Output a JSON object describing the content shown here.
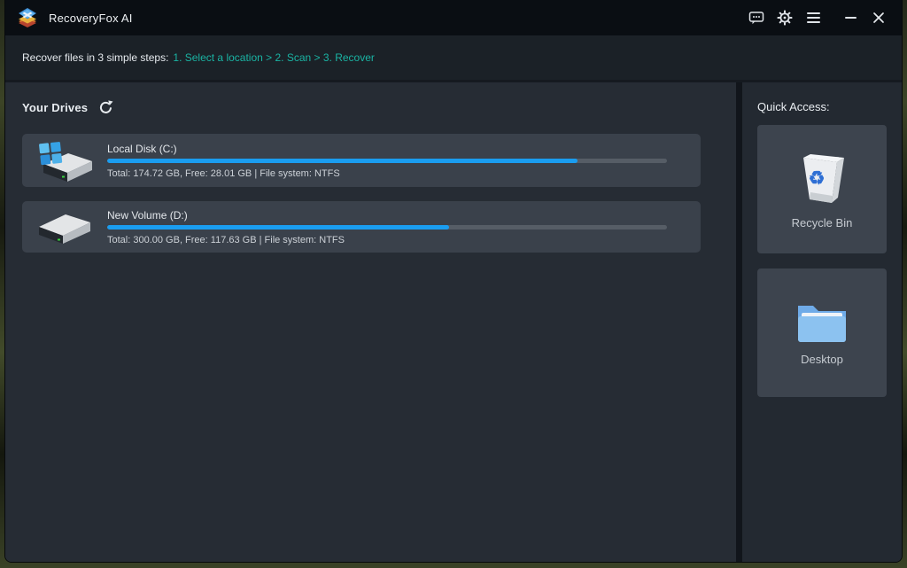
{
  "titlebar": {
    "title": "RecoveryFox AI",
    "icons": [
      "feedback-icon",
      "settings-gear-icon",
      "menu-icon",
      "minimize-icon",
      "close-icon"
    ]
  },
  "steps_bar": {
    "prefix": "Recover files in 3 simple steps:",
    "steps": "1. Select a location > 2. Scan > 3. Recover"
  },
  "drives": {
    "heading": "Your Drives",
    "refresh_icon": "refresh-icon",
    "items": [
      {
        "name": "Local Disk (C:)",
        "details": "Total: 174.72 GB, Free: 28.01 GB | File system: NTFS",
        "used_percent": 84,
        "fill_style": "width:84%",
        "icon": "system-drive-icon"
      },
      {
        "name": "New Volume (D:)",
        "details": "Total: 300.00 GB, Free: 117.63 GB | File system: NTFS",
        "used_percent": 61,
        "fill_style": "width:61%",
        "icon": "data-drive-icon"
      }
    ]
  },
  "quick_access": {
    "heading": "Quick Access:",
    "items": [
      {
        "label": "Recycle Bin",
        "icon": "recycle-bin-icon",
        "recycle_glyph": "♻"
      },
      {
        "label": "Desktop",
        "icon": "desktop-folder-icon"
      }
    ]
  },
  "colors": {
    "accent_teal": "#1ab3a3",
    "progress_blue": "#1a9df0",
    "titlebar_bg": "#0a0e13",
    "card_bg": "#3a414b",
    "main_bg": "#262c34"
  }
}
